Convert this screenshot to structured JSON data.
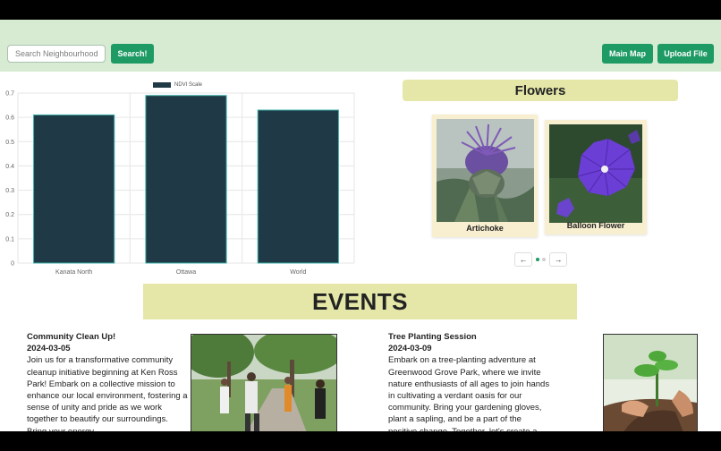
{
  "search": {
    "placeholder": "Search Neighbourhood",
    "button_label": "Search!"
  },
  "nav": {
    "main_map_label": "Main Map",
    "upload_label": "Upload File"
  },
  "chart_data": {
    "type": "bar",
    "categories": [
      "Kanata North",
      "Ottawa",
      "World"
    ],
    "series": [
      {
        "name": "NDVI Scale",
        "values": [
          0.61,
          0.69,
          0.63
        ]
      }
    ],
    "ylim": [
      0,
      0.7
    ],
    "yticks": [
      "0",
      "0.1",
      "0.2",
      "0.3",
      "0.4",
      "0.5",
      "0.6",
      "0.7"
    ],
    "bar_color": "#1f3a46",
    "bar_border": "#3fb0a8",
    "grid": true,
    "legend": "top-center"
  },
  "flowers": {
    "title": "Flowers",
    "cards": [
      {
        "name": "Artichoke"
      },
      {
        "name": "Balloon Flower"
      }
    ],
    "prev_icon": "←",
    "next_icon": "→"
  },
  "events": {
    "title": "EVENTS",
    "items": [
      {
        "title": "Community Clean Up!",
        "date": "2024-03-05",
        "description": "Join us for a transformative community cleanup initiative beginning at Ken Ross Park! Embark on a collective mission to enhance our local environment, fostering a sense of unity and pride as we work together to beautify our surroundings. Bring your energy"
      },
      {
        "title": "Tree Planting Session",
        "date": "2024-03-09",
        "description": "Embark on a tree-planting adventure at Greenwood Grove Park, where we invite nature enthusiasts of all ages to join hands in cultivating a verdant oasis for our community. Bring your gardening gloves, plant a sapling, and be a part of the positive change. Together, let's create a lasting impact on our local environment, one tree at a time."
      }
    ]
  },
  "colors": {
    "accent": "#1e9a64",
    "topbar": "#d6ebd1",
    "title_bg": "#e5e7a8",
    "card_bg": "#f7efcf"
  }
}
